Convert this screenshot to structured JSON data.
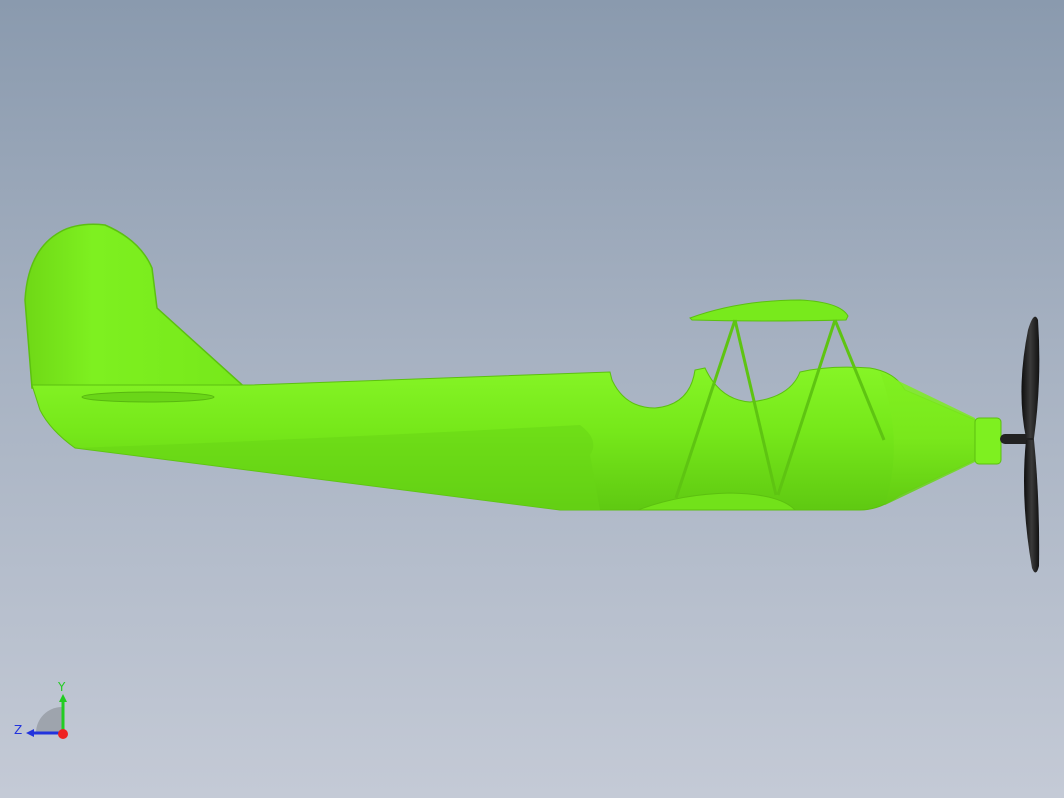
{
  "viewport": {
    "background_top": "#8a9aae",
    "background_bottom": "#c4cad6"
  },
  "model": {
    "description_icon": "biplane-3d-model",
    "body_color": "#7ded1c",
    "body_shade": "#5cc010",
    "propeller_color": "#1a1a1a"
  },
  "triad": {
    "y_label": "Y",
    "z_label": "Z",
    "y_color": "#22cc22",
    "z_color": "#2233dd",
    "x_color": "#ee2222"
  }
}
